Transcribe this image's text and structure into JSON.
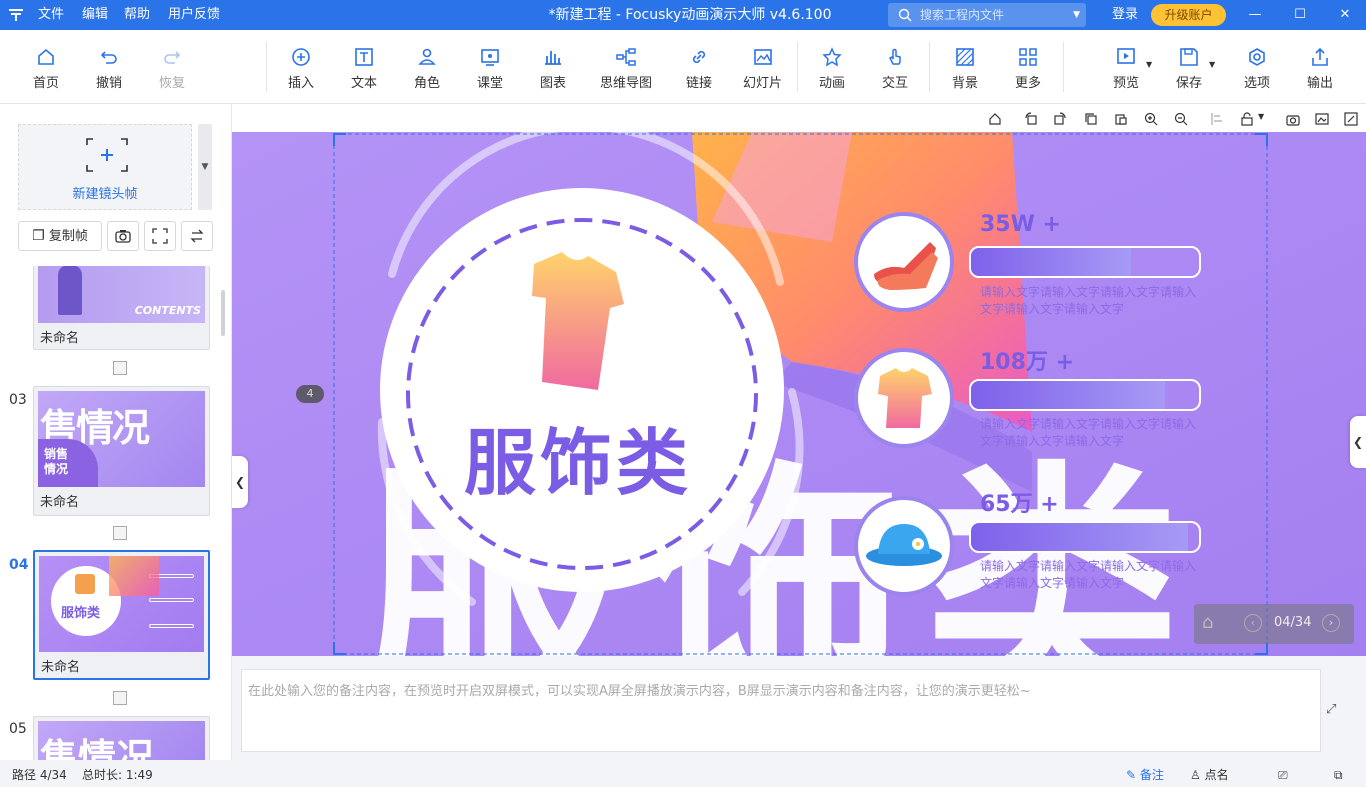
{
  "titlebar": {
    "menus": [
      "文件",
      "编辑",
      "帮助",
      "用户反馈"
    ],
    "title": "*新建工程 - Focusky动画演示大师  v4.6.100",
    "search_placeholder": "搜索工程内文件",
    "login": "登录",
    "upgrade": "升级账户"
  },
  "toolbar": {
    "home": "首页",
    "undo": "撤销",
    "redo": "恢复",
    "insert": "插入",
    "text": "文本",
    "role": "角色",
    "lesson": "课堂",
    "chart": "图表",
    "mindmap": "思维导图",
    "link": "链接",
    "slides": "幻灯片",
    "animation": "动画",
    "interact": "交互",
    "background": "背景",
    "more": "更多",
    "preview": "预览",
    "save": "保存",
    "options": "选项",
    "export": "输出"
  },
  "sidebar": {
    "new_frame": "新建镜头帧",
    "copy_frame": "复制帧",
    "slides": [
      {
        "num": "",
        "name": "未命名",
        "thumb_text": "CONTENTS"
      },
      {
        "num": "03",
        "name": "未命名",
        "thumb_text": "销售情况"
      },
      {
        "num": "04",
        "name": "未命名",
        "thumb_text": "服饰类"
      },
      {
        "num": "05",
        "name": "",
        "thumb_text": ""
      }
    ]
  },
  "stage": {
    "frame_badge": "4",
    "center_title": "服饰类",
    "big_text": "服饰类",
    "items": [
      {
        "stat": "35W +",
        "desc": "请输入文字请输入文字请输入文字请输入文字请输入文字请输入文字",
        "icon": "shoes-icon",
        "progress": 0.7
      },
      {
        "stat": "108万 +",
        "desc": "请输入文字请输入文字请输入文字请输入文字请输入文字请输入文字",
        "icon": "tshirt-icon",
        "progress": 0.85
      },
      {
        "stat": "65万 +",
        "desc": "请输入文字请输入文字请输入文字请输入文字请输入文字请输入文字",
        "icon": "hat-icon",
        "progress": 0.95
      }
    ],
    "page_indicator": "04/34"
  },
  "notes": {
    "placeholder": "在此处输入您的备注内容，在预览时开启双屏模式，可以实现A屏全屏播放演示内容，B屏显示演示内容和备注内容，让您的演示更轻松~"
  },
  "status": {
    "path": "路径 4/34",
    "duration": "总时长: 1:49",
    "notes": "备注",
    "rollcall": "点名"
  }
}
